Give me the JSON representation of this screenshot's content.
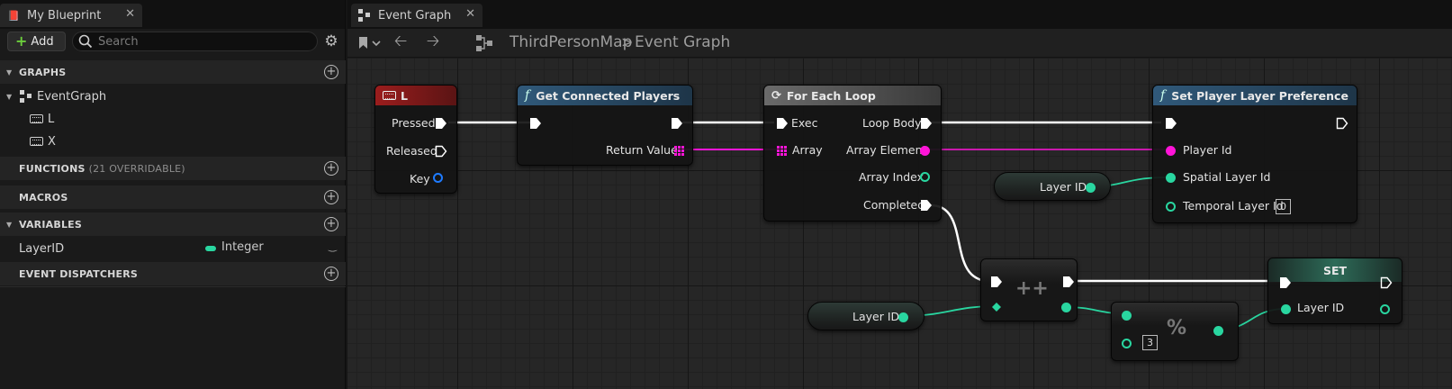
{
  "left_panel": {
    "tab_title": "My Blueprint",
    "add_label": "Add",
    "search_placeholder": "Search",
    "sections": {
      "graphs": "GRAPHS",
      "functions": "FUNCTIONS",
      "functions_count": "(21 OVERRIDABLE)",
      "macros": "MACROS",
      "variables": "VARIABLES",
      "dispatchers": "EVENT DISPATCHERS"
    },
    "graph_items": {
      "event_graph": "EventGraph",
      "events": [
        "L",
        "X"
      ]
    },
    "variables": [
      {
        "name": "LayerID",
        "type": "Integer",
        "type_color": "#29d6a0"
      }
    ]
  },
  "graph_panel": {
    "tab_title": "Event Graph",
    "breadcrumb": {
      "map": "ThirdPersonMap",
      "separator": ">",
      "graph": "Event Graph"
    }
  },
  "nodes": {
    "key_event": {
      "title": "L",
      "pins": {
        "pressed": "Pressed",
        "released": "Released",
        "key": "Key"
      }
    },
    "get_players": {
      "title": "Get Connected Players",
      "pins": {
        "return_value": "Return Value"
      }
    },
    "for_each": {
      "title": "For Each Loop",
      "pins": {
        "exec": "Exec",
        "array": "Array",
        "loop_body": "Loop Body",
        "array_element": "Array Element",
        "array_index": "Array Index",
        "completed": "Completed"
      }
    },
    "set_pref": {
      "title": "Set Player Layer Preference",
      "pins": {
        "player_id": "Player Id",
        "spatial": "Spatial Layer Id",
        "temporal": "Temporal Layer Id",
        "temporal_value": "0"
      }
    },
    "layer_get_1": {
      "label": "Layer ID"
    },
    "increment": {
      "symbol": "++"
    },
    "layer_get_2": {
      "label": "Layer ID"
    },
    "modulo": {
      "symbol": "%",
      "value": "3"
    },
    "set_var": {
      "title": "SET",
      "pin": "Layer ID"
    }
  },
  "colors": {
    "event_header": "#8a1a1a",
    "function_header": "#2f5574",
    "macro_header": "#5a5a5a",
    "integer": "#29d6a0",
    "object": "#ff14d8",
    "struct": "#1e7bff"
  }
}
